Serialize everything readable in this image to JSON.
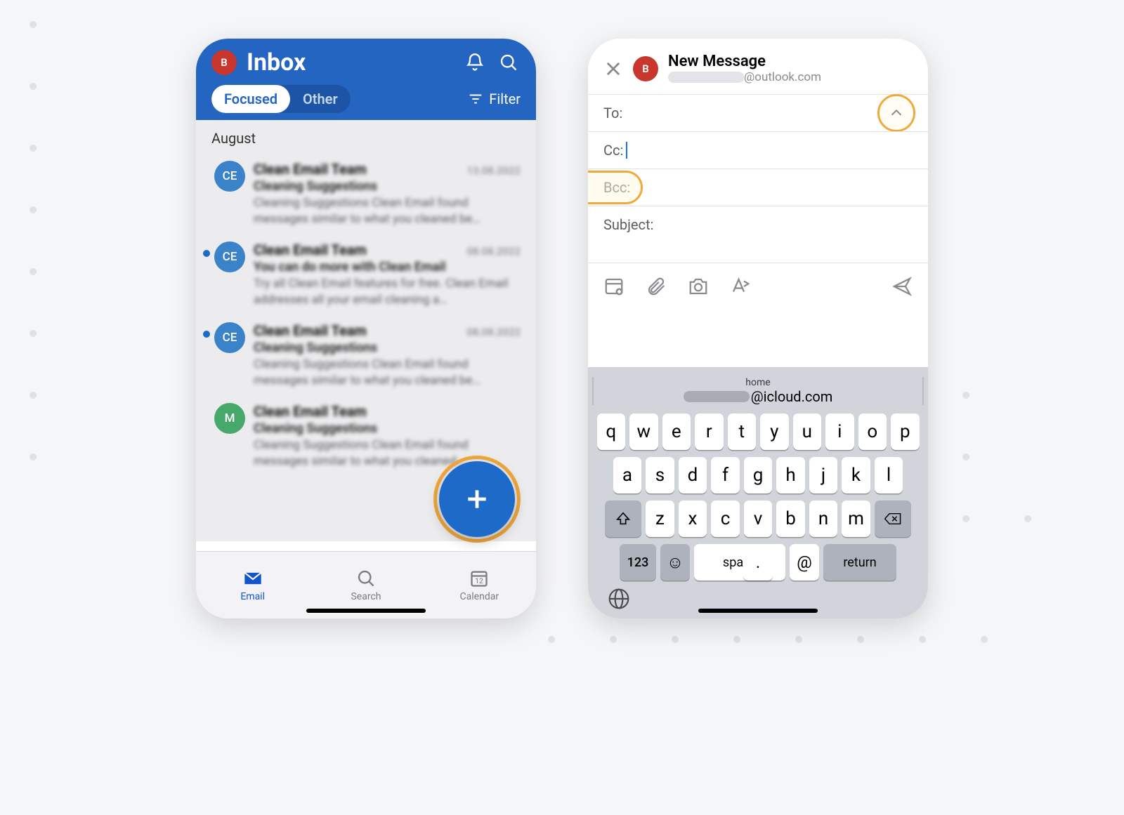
{
  "left": {
    "avatar_letter": "B",
    "title": "Inbox",
    "tabs": {
      "focused": "Focused",
      "other": "Other"
    },
    "filter": "Filter",
    "section": "August",
    "emails": [
      {
        "avatar": "CE",
        "avatar_color": "blue",
        "unread": false,
        "sender": "Clean Email Team",
        "date": "13.08.2022",
        "subject": "Cleaning Suggestions",
        "preview": "Cleaning Suggestions Clean Email found messages similar to what you cleaned be…"
      },
      {
        "avatar": "CE",
        "avatar_color": "blue",
        "unread": true,
        "sender": "Clean Email Team",
        "date": "08.08.2022",
        "subject": "You can do more with Clean Email",
        "preview": "Try all Clean Email features for free. Clean Email addresses all your email cleaning a…"
      },
      {
        "avatar": "CE",
        "avatar_color": "blue",
        "unread": true,
        "sender": "Clean Email Team",
        "date": "08.08.2022",
        "subject": "Cleaning Suggestions",
        "preview": "Cleaning Suggestions Clean Email found messages similar to what you cleaned be…"
      },
      {
        "avatar": "M",
        "avatar_color": "green",
        "unread": false,
        "sender": "Clean Email Team",
        "date": "",
        "subject": "Cleaning Suggestions",
        "preview": "Cleaning Suggestions Clean Email found messages similar to what you cleaned…"
      }
    ],
    "nav": {
      "email": "Email",
      "search": "Search",
      "calendar": "Calendar",
      "calendar_day": "12"
    }
  },
  "right": {
    "title": "New Message",
    "from_suffix": "@outlook.com",
    "avatar_letter": "B",
    "fields": {
      "to": "To:",
      "cc": "Cc:",
      "bcc": "Bcc:",
      "subject": "Subject:"
    },
    "keyboard": {
      "suggestion_label": "home",
      "suggestion_suffix": "@icloud.com",
      "row1": [
        "q",
        "w",
        "e",
        "r",
        "t",
        "y",
        "u",
        "i",
        "o",
        "p"
      ],
      "row2": [
        "a",
        "s",
        "d",
        "f",
        "g",
        "h",
        "j",
        "k",
        "l"
      ],
      "row3": [
        "z",
        "x",
        "c",
        "v",
        "b",
        "n",
        "m"
      ],
      "k123": "123",
      "space": "space",
      "at": "@",
      "dot": ".",
      "return": "return"
    }
  }
}
